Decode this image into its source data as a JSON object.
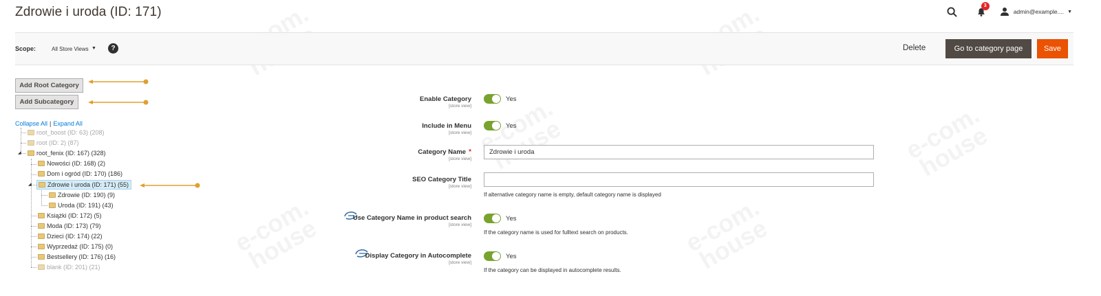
{
  "header": {
    "title": "Zdrowie i uroda (ID: 171)",
    "notifications_count": "3",
    "user_name": "admin@example...."
  },
  "scope": {
    "label": "Scope:",
    "value": "All Store Views",
    "help": "?"
  },
  "actions": {
    "delete": "Delete",
    "goto": "Go to category page",
    "save": "Save"
  },
  "left": {
    "add_root": "Add Root Category",
    "add_sub": "Add Subcategory",
    "collapse_all": "Collapse All",
    "separator": "|",
    "expand_all": "Expand All"
  },
  "tree": [
    {
      "label": "root_boost (ID: 63) (208)",
      "dim": true
    },
    {
      "label": "root (ID: 2) (87)",
      "dim": true
    },
    {
      "label": "root_fenix (ID: 167) (328)",
      "dim": false
    },
    {
      "label": "Nowości (ID: 168) (2)",
      "dim": false
    },
    {
      "label": "Dom i ogród (ID: 170) (186)",
      "dim": false
    },
    {
      "label": "Zdrowie i uroda (ID: 171) (55)",
      "dim": false,
      "selected": true
    },
    {
      "label": "Zdrowie (ID: 190) (9)",
      "dim": false
    },
    {
      "label": "Uroda (ID: 191) (43)",
      "dim": false
    },
    {
      "label": "Książki (ID: 172) (5)",
      "dim": false
    },
    {
      "label": "Moda (ID: 173) (79)",
      "dim": false
    },
    {
      "label": "Dzieci (ID: 174) (22)",
      "dim": false
    },
    {
      "label": "Wyprzedaż (ID: 175) (0)",
      "dim": false
    },
    {
      "label": "Bestsellery (ID: 176) (16)",
      "dim": false
    },
    {
      "label": "blank (ID: 201) (21)",
      "dim": true
    }
  ],
  "form": {
    "store_view": "[store view]",
    "enable_label": "Enable Category",
    "enable_value": "Yes",
    "menu_label": "Include in Menu",
    "menu_value": "Yes",
    "name_label": "Category Name",
    "name_required": "*",
    "name_value": "Zdrowie i uroda",
    "seo_label": "SEO Category Title",
    "seo_value": "",
    "seo_note": "If alternative category name is empty, default category name is displayed",
    "search_label": "Use Category Name in product search",
    "search_value": "Yes",
    "search_note": "If the category name is used for fulltext search on products.",
    "autocomplete_label": "Display Category in Autocomplete",
    "autocomplete_value": "Yes",
    "autocomplete_note": "If the category can be displayed in autocomplete results."
  },
  "colors": {
    "accent": "#eb5202",
    "toggle_on": "#79a22e",
    "link": "#007bdb",
    "annotation_arrow": "#e0a030"
  },
  "watermark": [
    "e-com.",
    "house"
  ]
}
